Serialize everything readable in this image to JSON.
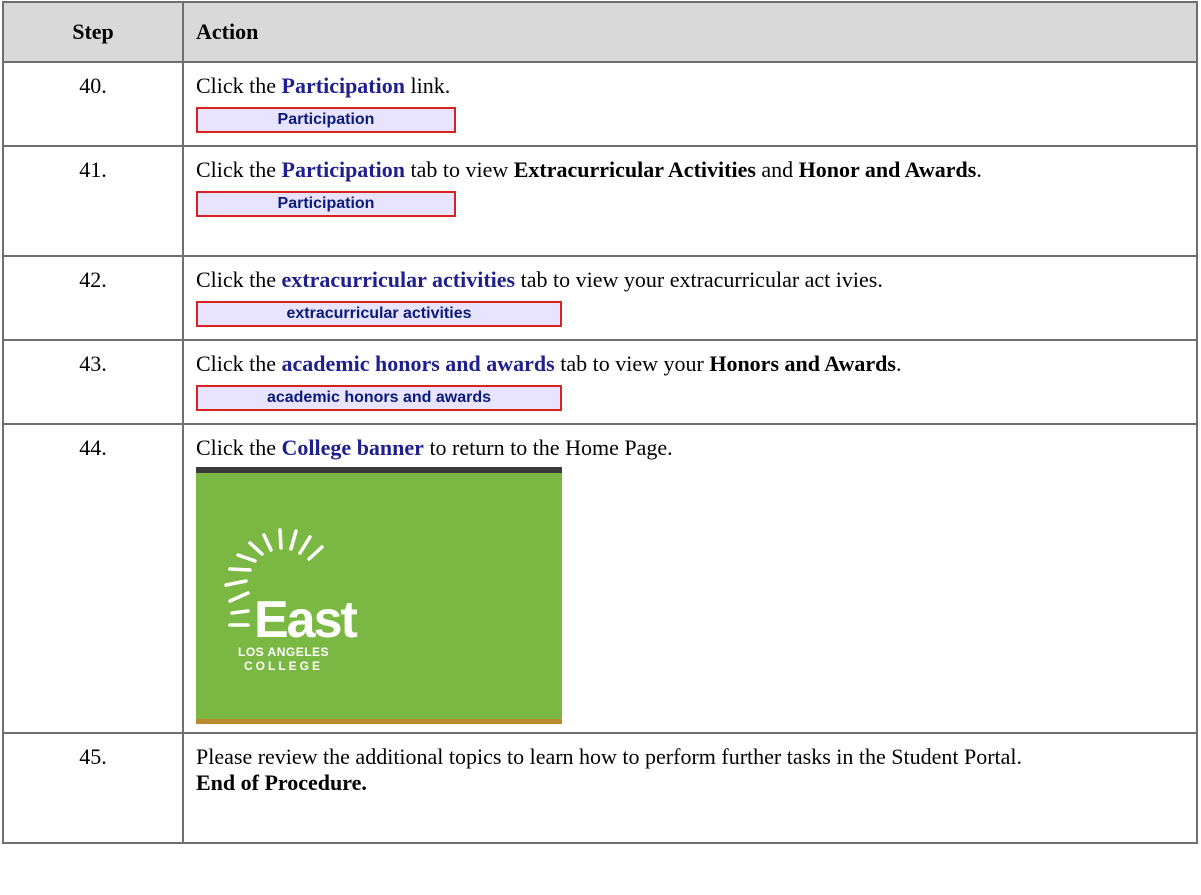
{
  "table": {
    "header": {
      "step": "Step",
      "action": "Action"
    },
    "rows": [
      {
        "step": "40.",
        "instr": [
          "Click the ",
          "Participation",
          " link."
        ],
        "ui_label": "Participation"
      },
      {
        "step": "41.",
        "instr": [
          "Click the ",
          "Participation",
          " tab to view ",
          "Extracurricular Activities",
          " and ",
          "Honor and Awards",
          "."
        ],
        "ui_label": "Participation"
      },
      {
        "step": "42.",
        "instr": [
          "Click the ",
          "extracurricular activities",
          " tab to view your extracurricular act ivies."
        ],
        "ui_label": "extracurricular activities"
      },
      {
        "step": "43.",
        "instr": [
          "Click the ",
          "academic honors and awards",
          " tab to view your ",
          "Honors and Awards",
          "."
        ],
        "ui_label": "academic honors and awards"
      },
      {
        "step": "44.",
        "instr": [
          "Click the ",
          "College banner",
          " to return to the Home Page."
        ],
        "banner": {
          "name": "East",
          "line1": "LOS ANGELES",
          "line2": "COLLEGE"
        }
      },
      {
        "step": "45.",
        "instr": [
          "Please review the additional topics to learn how to perform further tasks in the Student Portal."
        ],
        "end_text": "End of Procedure."
      }
    ]
  },
  "colors": {
    "header_bg": "#d9d9d9",
    "keyword": "#1f1f8f",
    "tab_bg": "#e8e4ff",
    "tab_border": "#d62222",
    "banner_green": "#7ab843"
  }
}
